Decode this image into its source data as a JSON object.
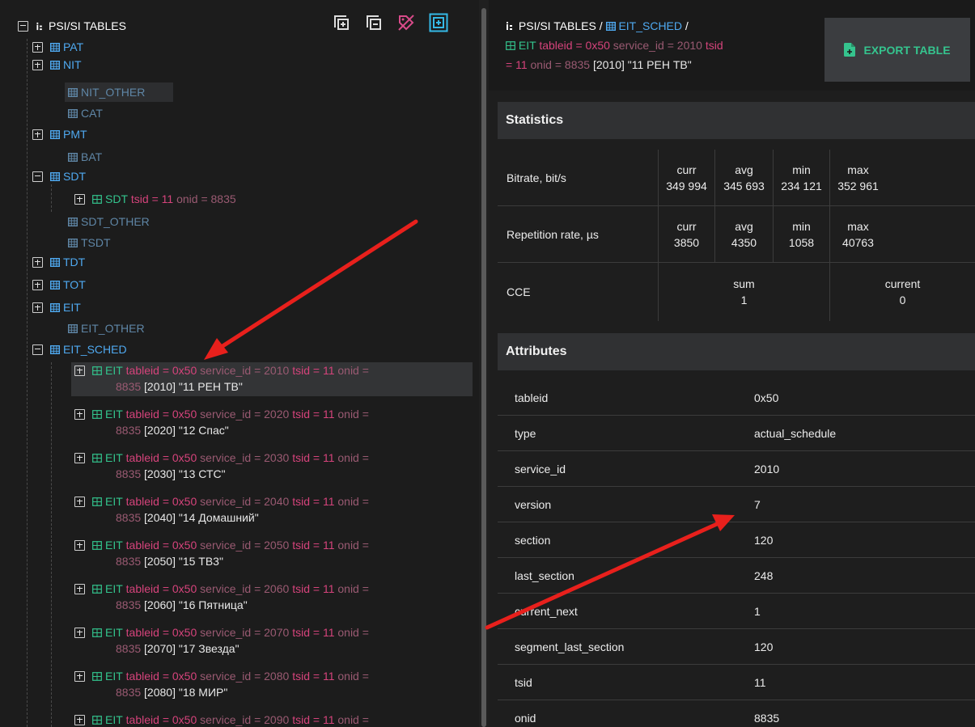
{
  "tree": {
    "root_label": "PSI/SI TABLES",
    "nodes": {
      "pat": "PAT",
      "nit": "NIT",
      "nit_other": "NIT_OTHER",
      "cat": "CAT",
      "pmt": "PMT",
      "bat": "BAT",
      "sdt": "SDT",
      "sdt_child": {
        "type": "SDT",
        "k1": "tsid",
        "v1": "= 11",
        "k2": "onid",
        "v2": "= 8835"
      },
      "sdt_other": "SDT_OTHER",
      "tsdt": "TSDT",
      "tdt": "TDT",
      "tot": "TOT",
      "eit": "EIT",
      "eit_other": "EIT_OTHER",
      "eit_sched": "EIT_SCHED"
    },
    "eit_items": [
      {
        "type": "EIT",
        "tableid_key": "tableid",
        "tableid_val": "= 0x50",
        "service_key": "service_id",
        "service_val": "= 2010",
        "tsid_key": "tsid",
        "tsid_val": "= 11",
        "onid_key": "onid",
        "onid_val": "=",
        "onid_num": "8835",
        "name": "[2010] \"11 РЕН ТВ\""
      },
      {
        "type": "EIT",
        "tableid_key": "tableid",
        "tableid_val": "= 0x50",
        "service_key": "service_id",
        "service_val": "= 2020",
        "tsid_key": "tsid",
        "tsid_val": "= 11",
        "onid_key": "onid",
        "onid_val": "=",
        "onid_num": "8835",
        "name": "[2020] \"12 Спас\""
      },
      {
        "type": "EIT",
        "tableid_key": "tableid",
        "tableid_val": "= 0x50",
        "service_key": "service_id",
        "service_val": "= 2030",
        "tsid_key": "tsid",
        "tsid_val": "= 11",
        "onid_key": "onid",
        "onid_val": "=",
        "onid_num": "8835",
        "name": "[2030] \"13 СТС\""
      },
      {
        "type": "EIT",
        "tableid_key": "tableid",
        "tableid_val": "= 0x50",
        "service_key": "service_id",
        "service_val": "= 2040",
        "tsid_key": "tsid",
        "tsid_val": "= 11",
        "onid_key": "onid",
        "onid_val": "=",
        "onid_num": "8835",
        "name": "[2040] \"14 Домашний\""
      },
      {
        "type": "EIT",
        "tableid_key": "tableid",
        "tableid_val": "= 0x50",
        "service_key": "service_id",
        "service_val": "= 2050",
        "tsid_key": "tsid",
        "tsid_val": "= 11",
        "onid_key": "onid",
        "onid_val": "=",
        "onid_num": "8835",
        "name": "[2050] \"15 ТВ3\""
      },
      {
        "type": "EIT",
        "tableid_key": "tableid",
        "tableid_val": "= 0x50",
        "service_key": "service_id",
        "service_val": "= 2060",
        "tsid_key": "tsid",
        "tsid_val": "= 11",
        "onid_key": "onid",
        "onid_val": "=",
        "onid_num": "8835",
        "name": "[2060] \"16 Пятница\""
      },
      {
        "type": "EIT",
        "tableid_key": "tableid",
        "tableid_val": "= 0x50",
        "service_key": "service_id",
        "service_val": "= 2070",
        "tsid_key": "tsid",
        "tsid_val": "= 11",
        "onid_key": "onid",
        "onid_val": "=",
        "onid_num": "8835",
        "name": "[2070] \"17 Звезда\""
      },
      {
        "type": "EIT",
        "tableid_key": "tableid",
        "tableid_val": "= 0x50",
        "service_key": "service_id",
        "service_val": "= 2080",
        "tsid_key": "tsid",
        "tsid_val": "= 11",
        "onid_key": "onid",
        "onid_val": "=",
        "onid_num": "8835",
        "name": "[2080] \"18 МИР\""
      },
      {
        "type": "EIT",
        "tableid_key": "tableid",
        "tableid_val": "= 0x50",
        "service_key": "service_id",
        "service_val": "= 2090",
        "tsid_key": "tsid",
        "tsid_val": "= 11",
        "onid_key": "onid",
        "onid_val": "=",
        "onid_num": "",
        "name": ""
      }
    ]
  },
  "header": {
    "breadcrumb_root": "PSI/SI TABLES",
    "sep1": "/",
    "breadcrumb_table": "EIT_SCHED",
    "sep2": "/",
    "sub_type": "EIT",
    "sub_tableid_key": "tableid",
    "sub_tableid_val": "= 0x50",
    "sub_service": "service_id = 2010",
    "sub_tsid_key": "tsid",
    "sub_line2": "= 11",
    "sub_onid": "onid = 8835",
    "sub_name": "[2010] \"11 РЕН ТВ\"",
    "export_label": "EXPORT TABLE"
  },
  "statistics": {
    "title": "Statistics",
    "bitrate": {
      "label": "Bitrate, bit/s",
      "curr_h": "curr",
      "curr": "349 994",
      "avg_h": "avg",
      "avg": "345 693",
      "min_h": "min",
      "min": "234 121",
      "max_h": "max",
      "max": "352 961"
    },
    "repetition": {
      "label": "Repetition rate, µs",
      "curr_h": "curr",
      "curr": "3850",
      "avg_h": "avg",
      "avg": "4350",
      "min_h": "min",
      "min": "1058",
      "max_h": "max",
      "max": "40763"
    },
    "cce": {
      "label": "CCE",
      "sum_h": "sum",
      "sum": "1",
      "current_h": "current",
      "current": "0"
    }
  },
  "attributes": {
    "title": "Attributes",
    "rows": [
      {
        "key": "tableid",
        "value": "0x50"
      },
      {
        "key": "type",
        "value": "actual_schedule"
      },
      {
        "key": "service_id",
        "value": "2010"
      },
      {
        "key": "version",
        "value": "7"
      },
      {
        "key": "section",
        "value": "120"
      },
      {
        "key": "last_section",
        "value": "248"
      },
      {
        "key": "current_next",
        "value": "1"
      },
      {
        "key": "segment_last_section",
        "value": "120"
      },
      {
        "key": "tsid",
        "value": "11"
      },
      {
        "key": "onid",
        "value": "8835"
      }
    ]
  },
  "colors": {
    "accent_blue": "#4fa9f0",
    "green": "#33c48d",
    "pink": "#d5437b",
    "arrow_red": "#e8201c"
  }
}
